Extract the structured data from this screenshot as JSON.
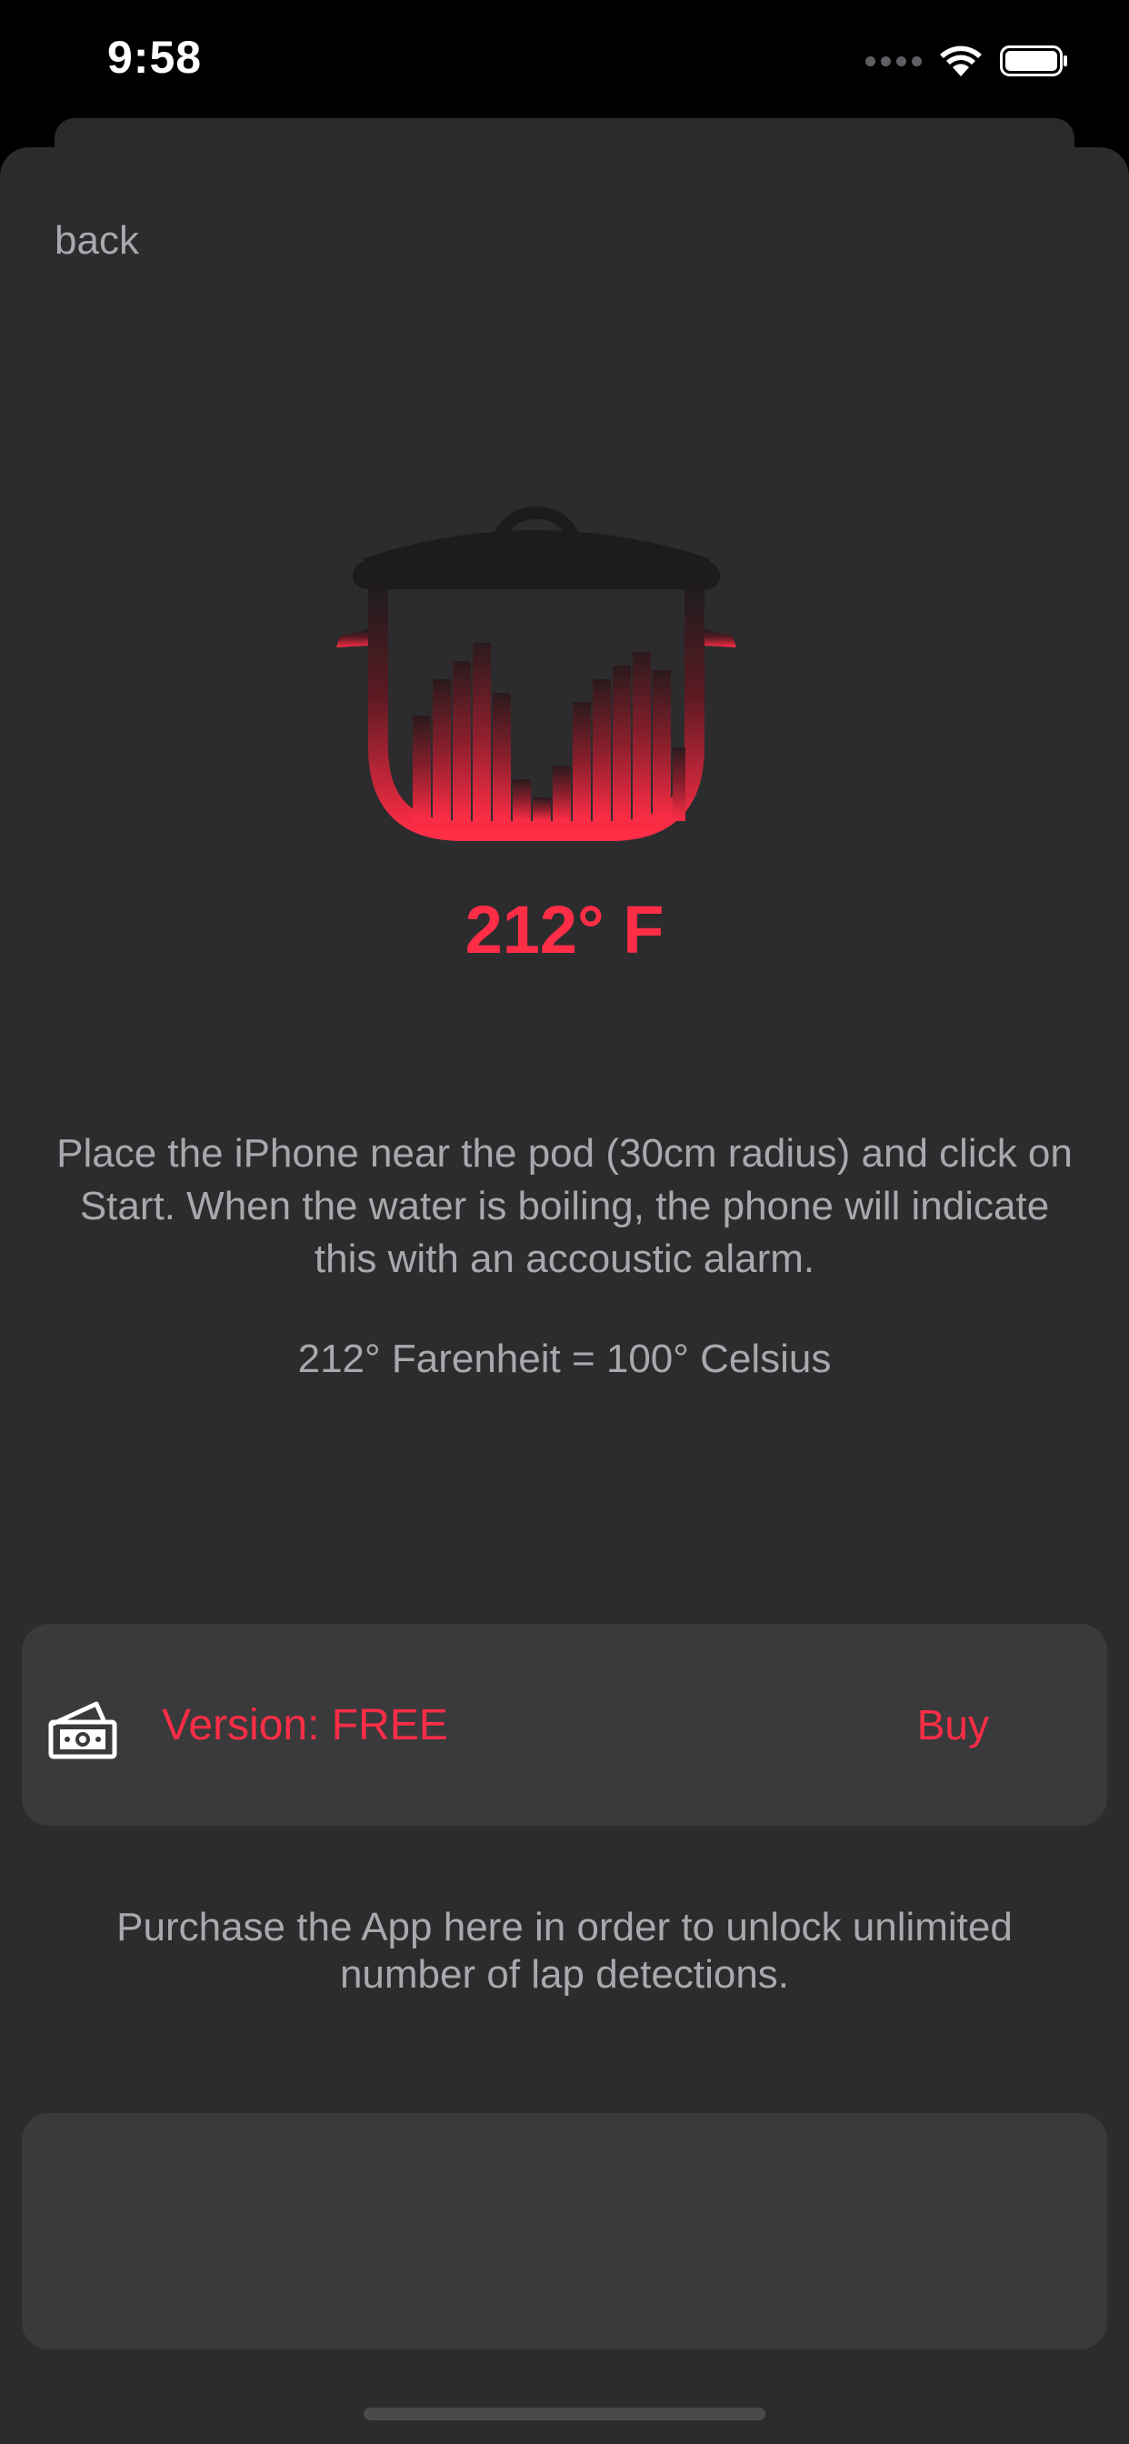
{
  "status_bar": {
    "time": "9:58"
  },
  "nav": {
    "back_label": "back"
  },
  "hero": {
    "icon": "boiling-pot-icon",
    "temperature": "212° F"
  },
  "instructions": {
    "text": "Place the iPhone near the pod (30cm radius) and click on Start. When the water is boiling, the phone will indicate this with an accoustic alarm.",
    "conversion": "212° Farenheit = 100° Celsius"
  },
  "version_card": {
    "icon": "money-icon",
    "title": "Version: FREE",
    "action": "Buy"
  },
  "purchase_note": "Purchase the App here in order to unlock unlimited number of lap detections.",
  "colors": {
    "accent": "#ff2d46",
    "background": "#2c2c2e",
    "card": "#3a3a3c",
    "text_secondary": "#a9a9ad"
  }
}
